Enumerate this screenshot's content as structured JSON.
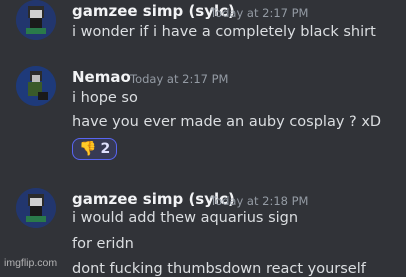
{
  "messages": [
    {
      "author": "gamzee simp (sylc)",
      "timestamp": "Today at 2:17 PM",
      "lines": [
        "i wonder if i have a completely black shirt"
      ]
    },
    {
      "author": "Nemao",
      "timestamp": "Today at 2:17 PM",
      "lines": [
        "i hope so",
        "have you ever made an auby cosplay ? xD"
      ],
      "reaction": {
        "emoji": "👎",
        "count": "2"
      }
    },
    {
      "author": "gamzee simp (sylc)",
      "timestamp": "Today at 2:18 PM",
      "lines": [
        "i would add thew aquarius sign",
        "for eridn",
        "dont fucking thumbsdown react yourself"
      ]
    }
  ],
  "watermark": "imgflip.com",
  "colors": {
    "background": "#313338",
    "reaction_border": "#5865f2",
    "reaction_bg": "#373a54"
  }
}
